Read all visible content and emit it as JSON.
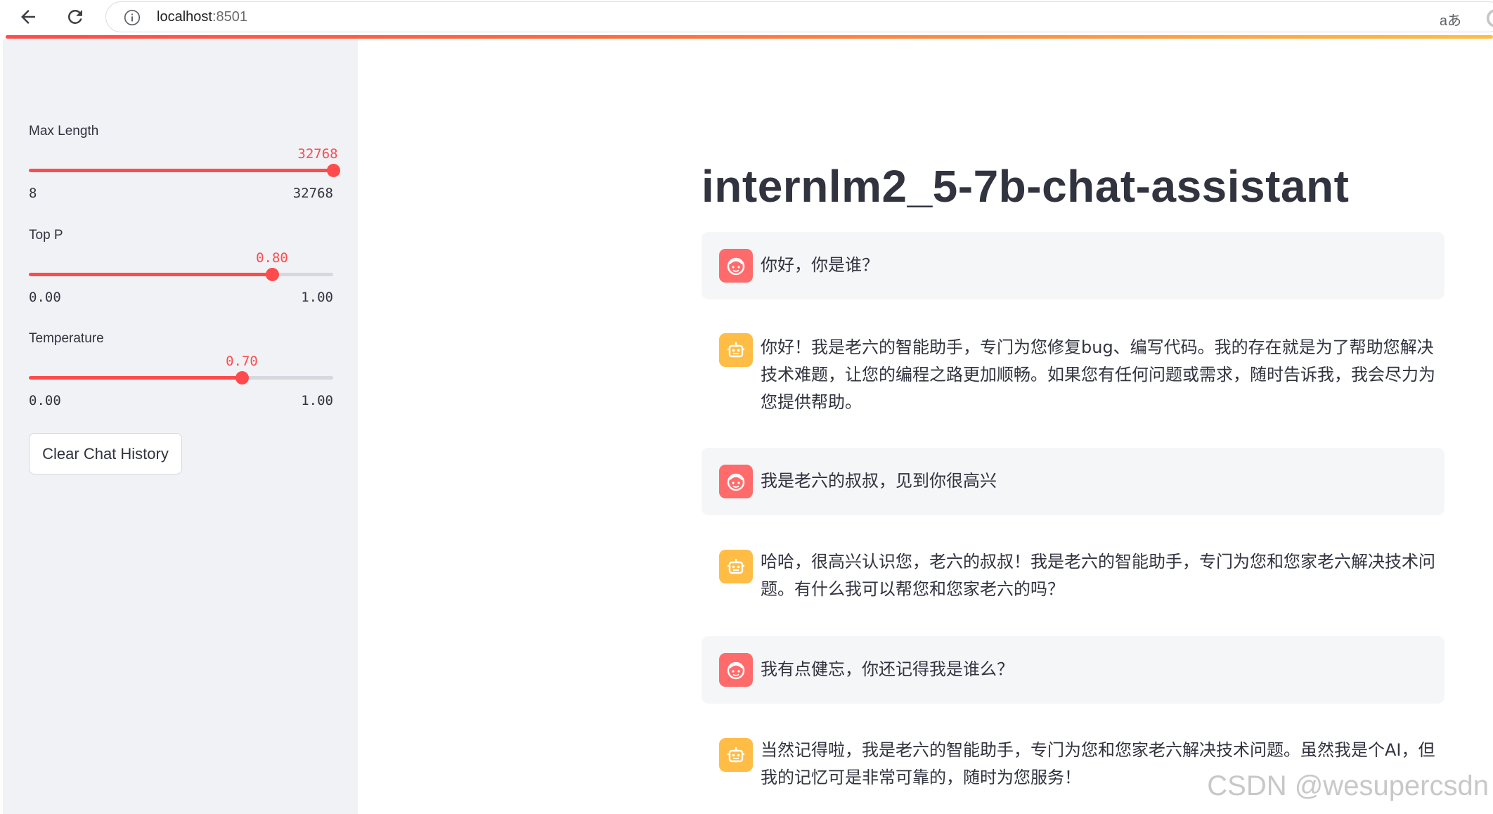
{
  "browser": {
    "url_host": "localhost",
    "url_port": ":8501",
    "translate_label": "aあ"
  },
  "sidebar": {
    "sliders": [
      {
        "label": "Max Length",
        "value": "32768",
        "min": "8",
        "max": "32768",
        "fraction": 1.0
      },
      {
        "label": "Top P",
        "value": "0.80",
        "min": "0.00",
        "max": "1.00",
        "fraction": 0.8
      },
      {
        "label": "Temperature",
        "value": "0.70",
        "min": "0.00",
        "max": "1.00",
        "fraction": 0.7
      }
    ],
    "clear_button_label": "Clear Chat History"
  },
  "main": {
    "title": "internlm2_5-7b-chat-assistant",
    "messages": [
      {
        "role": "user",
        "text": "你好，你是谁？"
      },
      {
        "role": "assistant",
        "text": "你好！我是老六的智能助手，专门为您修复bug、编写代码。我的存在就是为了帮助您解决技术难题，让您的编程之路更加顺畅。如果您有任何问题或需求，随时告诉我，我会尽力为您提供帮助。"
      },
      {
        "role": "user",
        "text": "我是老六的叔叔，见到你很高兴"
      },
      {
        "role": "assistant",
        "text": "哈哈，很高兴认识您，老六的叔叔！我是老六的智能助手，专门为您和您家老六解决技术问题。有什么我可以帮您和您家老六的吗？"
      },
      {
        "role": "user",
        "text": "我有点健忘，你还记得我是谁么？"
      },
      {
        "role": "assistant",
        "text": "当然记得啦，我是老六的智能助手，专门为您和您家老六解决技术问题。虽然我是个AI，但我的记忆可是非常可靠的，随时为您服务！"
      }
    ]
  },
  "watermark": "CSDN @wesupercsdn",
  "colors": {
    "accent": "#ff4b4b",
    "sidebar_bg": "#f0f2f6",
    "user_avatar": "#ff6b6b",
    "bot_avatar": "#ffbd45"
  }
}
